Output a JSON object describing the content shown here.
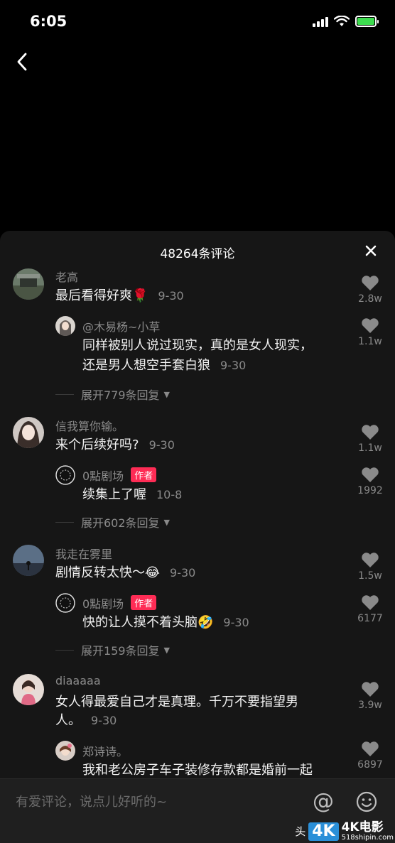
{
  "status_bar": {
    "time": "6:05",
    "icons": [
      "signal-icon",
      "wifi-icon",
      "battery-charging-icon"
    ]
  },
  "nav": {
    "back_icon": "chevron-left-icon"
  },
  "panel": {
    "title": "48264条评论",
    "close_icon": "close-icon"
  },
  "comments": [
    {
      "username": "老高",
      "text": "最后看得好爽🌹",
      "time": "9-30",
      "likes": "2.8w",
      "reply": {
        "username": "@木易杨~小草",
        "text_line1": "同样被别人说过现实，真的是女人现实，",
        "text_line2": "还是男人想空手套白狼",
        "time": "9-30",
        "likes": "1.1w"
      },
      "expand_label": "展开779条回复"
    },
    {
      "username": "信我算你输。",
      "text": "来个后续好吗?",
      "time": "9-30",
      "likes": "1.1w",
      "reply": {
        "username": "0點剧场",
        "badge": "作者",
        "text": "续集上了喔",
        "time": "10-8",
        "likes": "1992"
      },
      "expand_label": "展开602条回复"
    },
    {
      "username": "我走在雾里",
      "text": "剧情反转太快～😂",
      "time": "9-30",
      "likes": "1.5w",
      "reply": {
        "username": "0點剧场",
        "badge": "作者",
        "text": "快的让人摸不着头脑🤣",
        "time": "9-30",
        "likes": "6177"
      },
      "expand_label": "展开159条回复"
    },
    {
      "username": "diaaaaa",
      "text_line1": "女人得最爱自己才是真理。千万不要指望男",
      "text_line2": "人。",
      "time": "9-30",
      "likes": "3.9w",
      "reply": {
        "username": "郑诗诗。",
        "text": "我和老公房子车子装修存款都是婚前一起",
        "likes": "6897"
      }
    }
  ],
  "input": {
    "placeholder": "有爱评论，说点儿好听的~",
    "at_symbol": "@",
    "emoji_icon": "smiley-icon"
  },
  "watermark": {
    "partial_text": "头",
    "badge": "4K",
    "badge_sub": "ULTRA HD",
    "brand": "4K电影",
    "site": "518shipin.com"
  },
  "colors": {
    "accent": "#fe2c55",
    "panel_bg": "#161616",
    "muted_text": "#8a8a8a",
    "battery": "#3ddc4f"
  }
}
